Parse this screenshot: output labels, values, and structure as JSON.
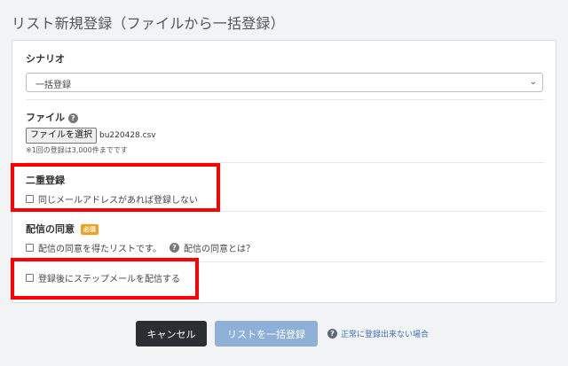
{
  "page": {
    "title": "リスト新規登録（ファイルから一括登録）"
  },
  "scenario": {
    "label": "シナリオ",
    "selected": "一括登録"
  },
  "file": {
    "label": "ファイル",
    "choose_button": "ファイルを選択",
    "file_name": "bu220428.csv",
    "note": "※1回の登録は3,000件までです"
  },
  "duplicate": {
    "label": "二重登録",
    "option": "同じメールアドレスがあれば登録しない"
  },
  "consent": {
    "label": "配信の同意",
    "required_badge": "必須",
    "option": "配信の同意を得たリストです。",
    "help_link": "配信の同意とは？"
  },
  "step_mail": {
    "option": "登録後にステップメールを配信する"
  },
  "actions": {
    "cancel": "キャンセル",
    "submit": "リストを一括登録",
    "help_link": "正常に登録出来ない場合"
  },
  "colors": {
    "highlight": "#ff0000",
    "primary_disabled": "#8eb0d6",
    "dark_button": "#2b2f33"
  }
}
